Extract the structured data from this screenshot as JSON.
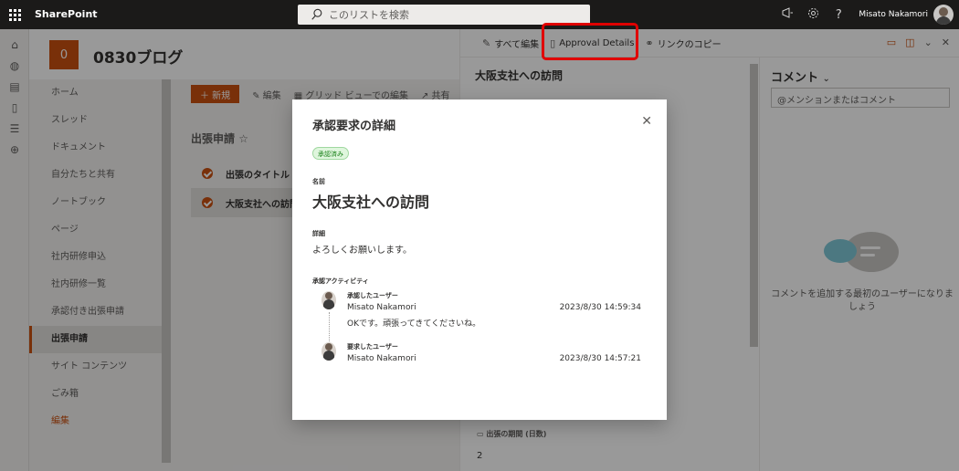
{
  "suitebar": {
    "brand": "SharePoint",
    "search_placeholder": "このリストを検索",
    "icons": [
      "megaphone-icon",
      "gear-icon",
      "help-icon"
    ],
    "help_glyph": "?",
    "user_name": "Misato Nakamori"
  },
  "site": {
    "logo_letter": "0",
    "title": "0830ブログ"
  },
  "leftnav": {
    "items": [
      {
        "label": "ホーム"
      },
      {
        "label": "スレッド"
      },
      {
        "label": "ドキュメント"
      },
      {
        "label": "自分たちと共有"
      },
      {
        "label": "ノートブック"
      },
      {
        "label": "ページ"
      },
      {
        "label": "社内研修申込"
      },
      {
        "label": "社内研修一覧"
      },
      {
        "label": "承認付き出張申請"
      },
      {
        "label": "出張申請"
      },
      {
        "label": "サイト コンテンツ"
      },
      {
        "label": "ごみ箱"
      },
      {
        "label": "編集"
      }
    ],
    "active_index": 9
  },
  "list": {
    "cmd_new": "＋ 新規",
    "cmd_edit": "編集",
    "cmd_grid": "グリッド ビューでの編集",
    "cmd_share": "共有",
    "title": "出張申請",
    "rows": [
      {
        "title": "出張のタイトル"
      },
      {
        "title": "大阪支社への訪問"
      }
    ]
  },
  "panel": {
    "edit_all": "すべて編集",
    "approval_details": "Approval Details",
    "copy_link": "リンクのコピー",
    "item_title": "大阪支社への訪問",
    "field_label": "出張の期間 (日数)",
    "field_value": "2",
    "comments_heading": "コメント",
    "comment_placeholder": "@メンションまたはコメント",
    "comment_empty": "コメントを追加する最初のユーザーになりましょう"
  },
  "dialog": {
    "title": "承認要求の詳細",
    "status_badge": "承認済み",
    "name_label": "名前",
    "name_value": "大阪支社への訪問",
    "details_label": "詳細",
    "details_value": "よろしくお願いします。",
    "activity_label": "承認アクティビティ",
    "activities": [
      {
        "role": "承認したユーザー",
        "user": "Misato Nakamori",
        "comment": "OKです。頑張ってきてくださいね。",
        "time": "2023/8/30 14:59:34"
      },
      {
        "role": "要求したユーザー",
        "user": "Misato Nakamori",
        "time": "2023/8/30 14:57:21"
      }
    ]
  },
  "colors": {
    "brand_orange": "#ca5010",
    "approved_green": "#107c10",
    "highlight_red": "#e00000"
  }
}
